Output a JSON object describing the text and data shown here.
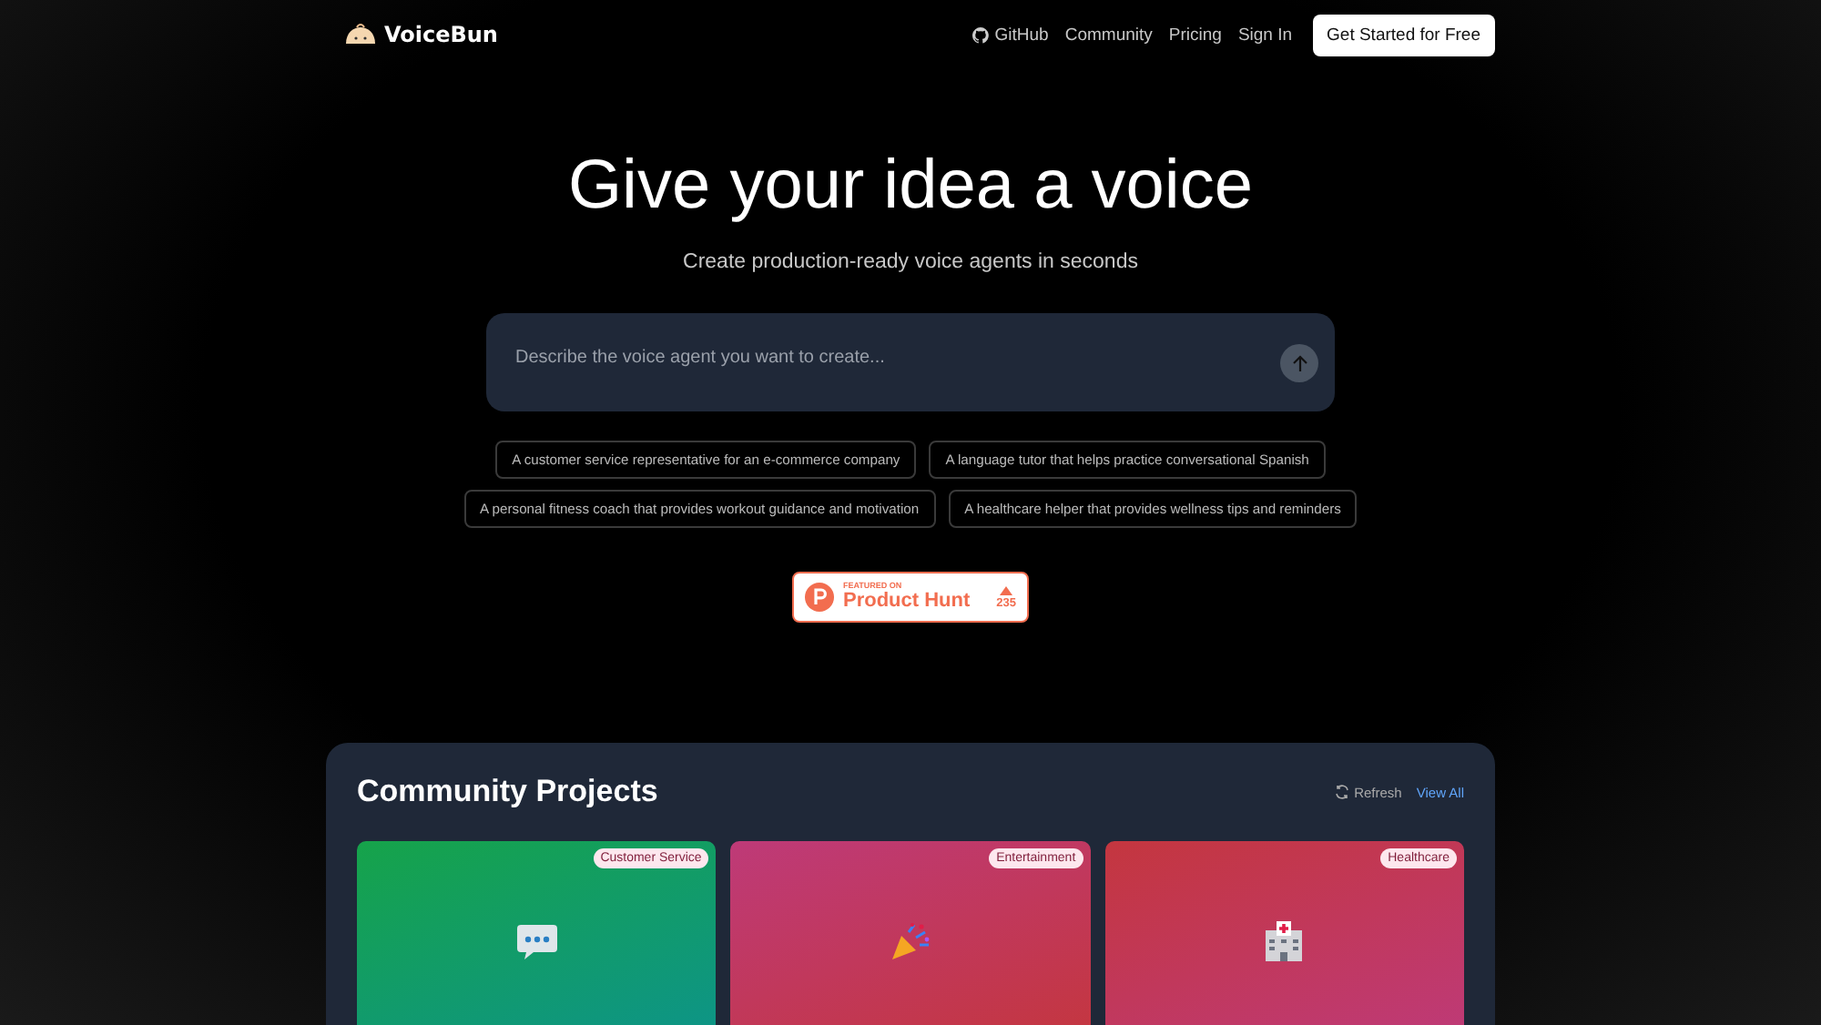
{
  "brand": "VoiceBun",
  "nav": [
    {
      "label": "GitHub",
      "kind": "github"
    },
    {
      "label": "Community",
      "kind": "link"
    },
    {
      "label": "Pricing",
      "kind": "link"
    },
    {
      "label": "Sign In",
      "kind": "link"
    }
  ],
  "cta": "Get Started for Free",
  "hero": {
    "title": "Give your idea a voice",
    "subtitle": "Create production-ready voice agents in seconds"
  },
  "prompt": {
    "placeholder": "Describe the voice agent you want to create..."
  },
  "suggestions": [
    [
      "A customer service representative for an e-commerce company",
      "A language tutor that helps practice conversational Spanish"
    ],
    [
      "A personal fitness coach that provides workout guidance and motivation",
      "A healthcare helper that provides wellness tips and reminders"
    ]
  ],
  "product_hunt": {
    "featured": "FEATURED ON",
    "name": "Product Hunt",
    "votes": "235"
  },
  "community": {
    "title": "Community Projects",
    "refresh": "Refresh",
    "view_all": "View All",
    "cards": [
      {
        "tag": "Customer Service",
        "kind": "chat",
        "color": "#16a34a"
      },
      {
        "tag": "Entertainment",
        "kind": "party",
        "color": "#be3a78"
      },
      {
        "tag": "Healthcare",
        "kind": "hospital",
        "color": "#c4363f"
      }
    ]
  }
}
